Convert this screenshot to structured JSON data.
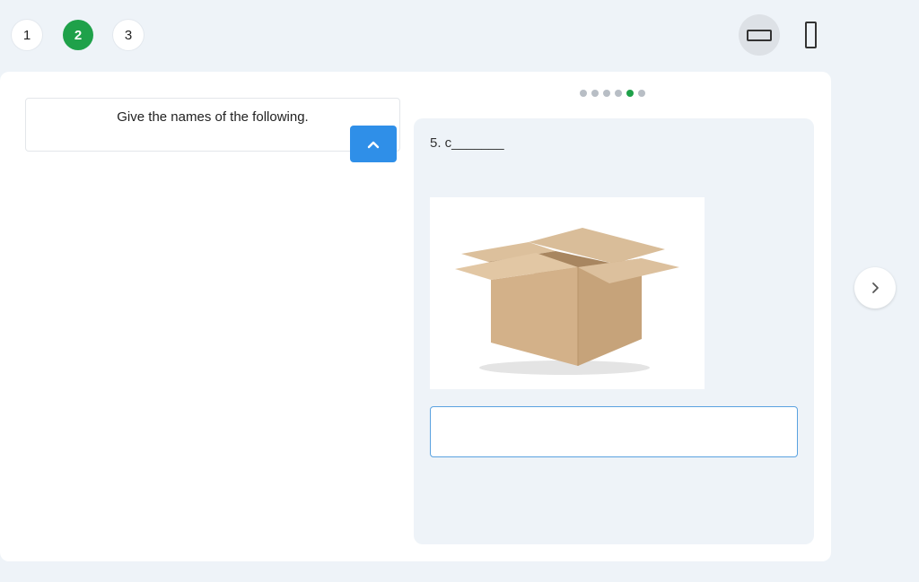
{
  "steps": [
    {
      "label": "1",
      "active": false
    },
    {
      "label": "2",
      "active": true
    },
    {
      "label": "3",
      "active": false
    }
  ],
  "view_toggle": {
    "selected": "landscape"
  },
  "instruction": {
    "text": "Give the names of the following."
  },
  "progress": {
    "total": 6,
    "current": 5
  },
  "question": {
    "text": "5. c_______",
    "image": "cardboard-box-image",
    "answer_value": ""
  },
  "colors": {
    "accent_green": "#1fa14a",
    "button_blue": "#2f8fe8",
    "page_bg": "#eef3f8"
  },
  "icons": {
    "collapse": "chevron-up-icon",
    "next": "chevron-right-icon",
    "landscape": "landscape-view-icon",
    "portrait": "portrait-view-icon"
  }
}
